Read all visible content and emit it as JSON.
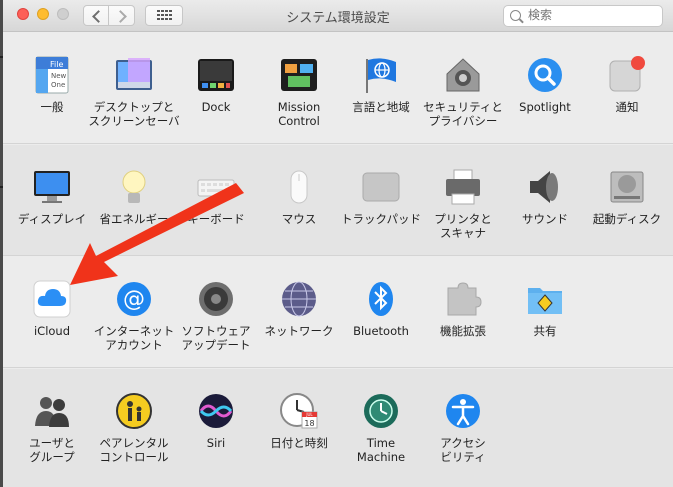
{
  "window": {
    "title": "システム環境設定",
    "search_placeholder": "検索"
  },
  "sections": [
    {
      "panes": [
        {
          "id": "general",
          "label": "一般",
          "icon": "general-file-icon",
          "icon_text": [
            "File",
            "New",
            "One"
          ]
        },
        {
          "id": "desktop",
          "label": "デスクトップと\nスクリーンセーバ",
          "icon": "desktop-screensaver-icon"
        },
        {
          "id": "dock",
          "label": "Dock",
          "icon": "dock-icon"
        },
        {
          "id": "mission",
          "label": "Mission\nControl",
          "icon": "mission-control-icon"
        },
        {
          "id": "language",
          "label": "言語と地域",
          "icon": "language-flag-icon"
        },
        {
          "id": "security",
          "label": "セキュリティと\nプライバシー",
          "icon": "security-house-icon"
        },
        {
          "id": "spotlight",
          "label": "Spotlight",
          "icon": "spotlight-icon"
        },
        {
          "id": "notifications",
          "label": "通知",
          "icon": "notifications-icon"
        }
      ]
    },
    {
      "panes": [
        {
          "id": "displays",
          "label": "ディスプレイ",
          "icon": "display-icon"
        },
        {
          "id": "energy",
          "label": "省エネルギー",
          "icon": "energy-bulb-icon"
        },
        {
          "id": "keyboard",
          "label": "キーボード",
          "icon": "keyboard-icon"
        },
        {
          "id": "mouse",
          "label": "マウス",
          "icon": "mouse-icon"
        },
        {
          "id": "trackpad",
          "label": "トラックパッド",
          "icon": "trackpad-icon"
        },
        {
          "id": "printers",
          "label": "プリンタと\nスキャナ",
          "icon": "printer-icon"
        },
        {
          "id": "sound",
          "label": "サウンド",
          "icon": "speaker-icon"
        },
        {
          "id": "startup",
          "label": "起動ディスク",
          "icon": "startup-disk-icon"
        }
      ]
    },
    {
      "panes": [
        {
          "id": "icloud",
          "label": "iCloud",
          "icon": "icloud-icon"
        },
        {
          "id": "internet",
          "label": "インターネット\nアカウント",
          "icon": "internet-accounts-icon",
          "icon_text": "@"
        },
        {
          "id": "swupdate",
          "label": "ソフトウェア\nアップデート",
          "icon": "software-update-gear-icon"
        },
        {
          "id": "network",
          "label": "ネットワーク",
          "icon": "network-globe-icon"
        },
        {
          "id": "bluetooth",
          "label": "Bluetooth",
          "icon": "bluetooth-icon"
        },
        {
          "id": "extensions",
          "label": "機能拡張",
          "icon": "extensions-puzzle-icon"
        },
        {
          "id": "sharing",
          "label": "共有",
          "icon": "sharing-folder-icon"
        }
      ]
    },
    {
      "panes": [
        {
          "id": "users",
          "label": "ユーザと\nグループ",
          "icon": "users-groups-icon"
        },
        {
          "id": "parental",
          "label": "ペアレンタル\nコントロール",
          "icon": "parental-controls-icon"
        },
        {
          "id": "siri",
          "label": "Siri",
          "icon": "siri-icon"
        },
        {
          "id": "datetime",
          "label": "日付と時刻",
          "icon": "date-time-clock-icon",
          "icon_text": [
            "JUL",
            "18"
          ]
        },
        {
          "id": "timemachine",
          "label": "Time\nMachine",
          "icon": "time-machine-icon"
        },
        {
          "id": "accessibility",
          "label": "アクセシ\nビリティ",
          "icon": "accessibility-icon"
        }
      ]
    }
  ],
  "annotation": {
    "color": "#f0331a",
    "target": "icloud",
    "icon": "red-arrow-annotation"
  },
  "colors": {
    "close": "#fd5f57",
    "minimize": "#febc2e",
    "accent": "#1a8cff"
  }
}
